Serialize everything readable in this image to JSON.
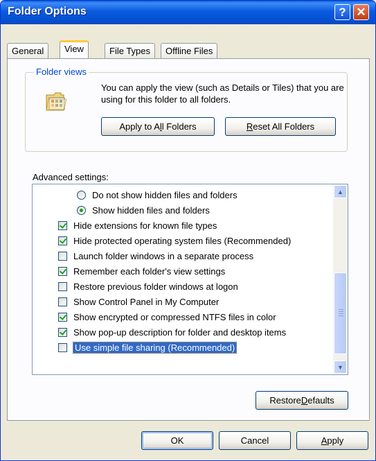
{
  "window": {
    "title": "Folder Options"
  },
  "titlebar": {
    "help_label": "?",
    "close_label": "✕"
  },
  "tabs": [
    {
      "label": "General",
      "active": false
    },
    {
      "label": "View",
      "active": true
    },
    {
      "label": "File Types",
      "active": false
    },
    {
      "label": "Offline Files",
      "active": false
    }
  ],
  "folder_views": {
    "legend": "Folder views",
    "description": "You can apply the view (such as Details or Tiles) that you are using for this folder to all folders.",
    "apply_button": {
      "pre": "Apply to A",
      "accel": "l",
      "post": "l Folders"
    },
    "reset_button": {
      "pre": "",
      "accel": "R",
      "post": "eset All Folders"
    },
    "icon": "folder-icon"
  },
  "advanced": {
    "label": "Advanced settings:",
    "items": [
      {
        "type": "radio",
        "checked": false,
        "label": "Do not show hidden files and folders"
      },
      {
        "type": "radio",
        "checked": true,
        "label": "Show hidden files and folders"
      },
      {
        "type": "checkbox",
        "checked": true,
        "label": "Hide extensions for known file types"
      },
      {
        "type": "checkbox",
        "checked": true,
        "label": "Hide protected operating system files (Recommended)"
      },
      {
        "type": "checkbox",
        "checked": false,
        "label": "Launch folder windows in a separate process"
      },
      {
        "type": "checkbox",
        "checked": true,
        "label": "Remember each folder's view settings"
      },
      {
        "type": "checkbox",
        "checked": false,
        "label": "Restore previous folder windows at logon"
      },
      {
        "type": "checkbox",
        "checked": false,
        "label": "Show Control Panel in My Computer"
      },
      {
        "type": "checkbox",
        "checked": true,
        "label": "Show encrypted or compressed NTFS files in color"
      },
      {
        "type": "checkbox",
        "checked": true,
        "label": "Show pop-up description for folder and desktop items"
      },
      {
        "type": "checkbox",
        "checked": false,
        "selected": true,
        "label": "Use simple file sharing (Recommended)"
      }
    ],
    "scroll_up": "▲",
    "scroll_down": "▼"
  },
  "restore_button": {
    "pre": "Restore ",
    "accel": "D",
    "post": "efaults"
  },
  "footer": {
    "ok": "OK",
    "cancel": "Cancel",
    "apply": {
      "pre": "",
      "accel": "A",
      "post": "pply"
    }
  },
  "colors": {
    "titlebar": "#0a5ae0",
    "check": "#21a121",
    "selection": "#316ac5",
    "tab_highlight": "#ffc83c"
  }
}
